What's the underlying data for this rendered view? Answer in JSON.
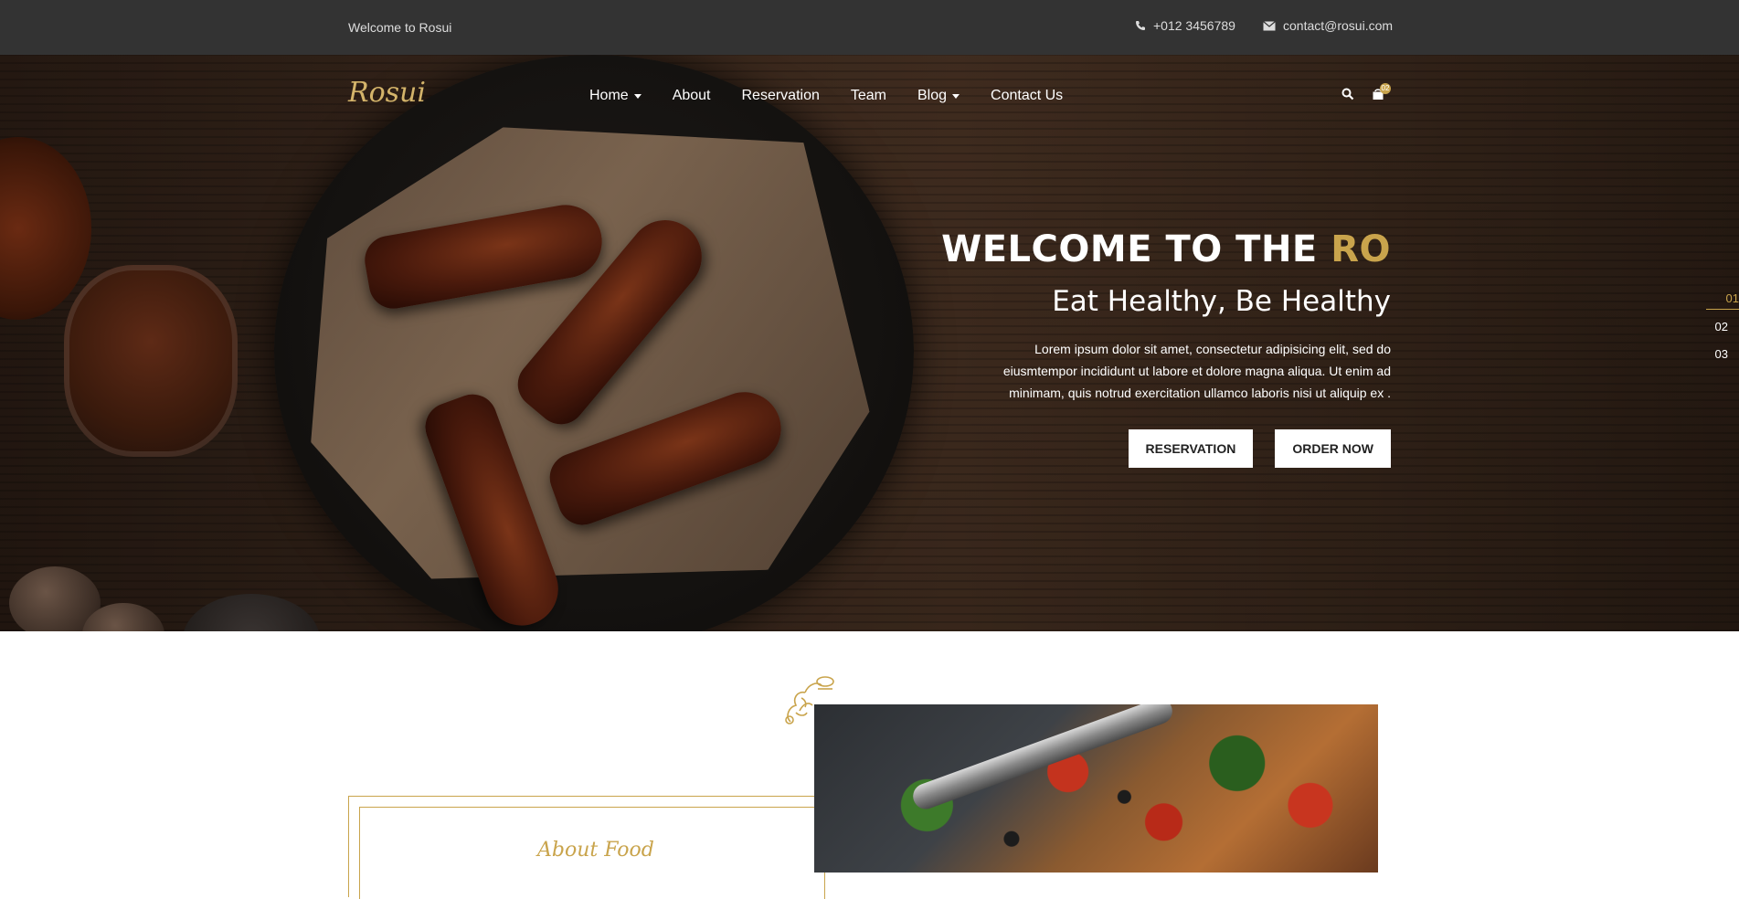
{
  "topbar": {
    "welcome": "Welcome to Rosui",
    "phone": "+012 3456789",
    "email": "contact@rosui.com"
  },
  "nav": {
    "logo": "Rosui",
    "items": [
      {
        "label": "Home",
        "dropdown": true
      },
      {
        "label": "About",
        "dropdown": false
      },
      {
        "label": "Reservation",
        "dropdown": false
      },
      {
        "label": "Team",
        "dropdown": false
      },
      {
        "label": "Blog",
        "dropdown": true
      },
      {
        "label": "Contact Us",
        "dropdown": false
      }
    ],
    "cart_count": "02"
  },
  "hero": {
    "title_main": "WELCOME TO THE ",
    "title_accent": "RO",
    "subtitle": "Eat Healthy, Be Healthy",
    "description": "Lorem ipsum dolor sit amet, consectetur adipisicing elit, sed do eiusmtempor incididunt ut labore et dolore magna aliqua. Ut enim ad minimam, quis notrud exercitation ullamco laboris nisi ut aliquip ex .",
    "btn_reservation": "RESERVATION",
    "btn_order": "ORDER NOW"
  },
  "slides": [
    "01",
    "02",
    "03"
  ],
  "about": {
    "title": "About Food"
  },
  "colors": {
    "accent": "#c9a44c",
    "topbar": "#333333"
  }
}
